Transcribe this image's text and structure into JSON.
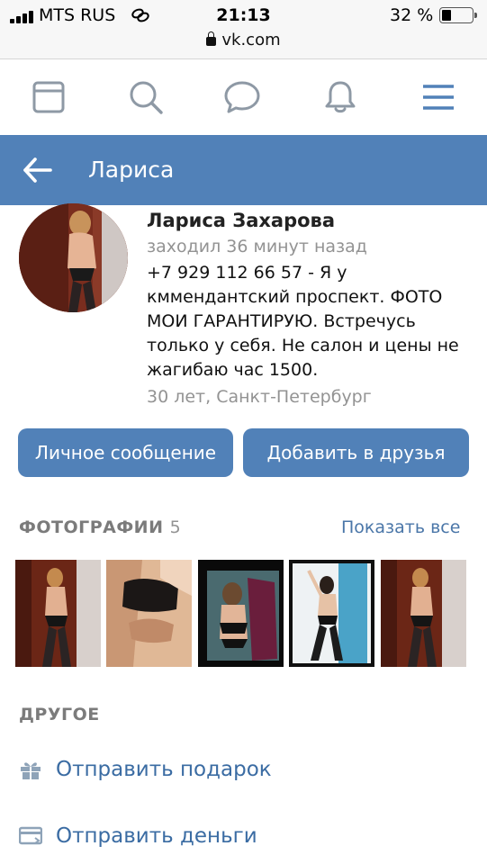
{
  "status_bar": {
    "carrier": "MTS RUS",
    "time": "21:13",
    "battery_percent": "32 %",
    "battery_level": 0.32,
    "url": "vk.com"
  },
  "top_nav": {
    "icons": [
      "feed-icon",
      "search-icon",
      "messages-icon",
      "notifications-icon",
      "menu-icon"
    ],
    "accent_color": "#5181b8"
  },
  "header": {
    "title": "Лариса",
    "background_color": "#5181b8"
  },
  "profile": {
    "name": "Лариса Захарова",
    "last_seen": "заходил 36 минут назад",
    "status": "+7 929 112 66 57 - Я у кммендантский проспект. ФОТО МОИ ГАРАНТИРУЮ. Встречусь только у себя. Не салон и цены не жагибаю час 1500.",
    "info": "30 лет, Санкт-Петербург"
  },
  "actions": {
    "message_label": "Личное сообщение",
    "add_friend_label": "Добавить в друзья"
  },
  "photos": {
    "title": "ФОТОГРАФИИ",
    "count": "5",
    "show_all_label": "Показать все",
    "thumbnails": 5
  },
  "other": {
    "title": "ДРУГОЕ",
    "items": [
      {
        "label": "Отправить подарок",
        "icon": "gift-icon"
      },
      {
        "label": "Отправить деньги",
        "icon": "money-transfer-icon"
      }
    ]
  }
}
